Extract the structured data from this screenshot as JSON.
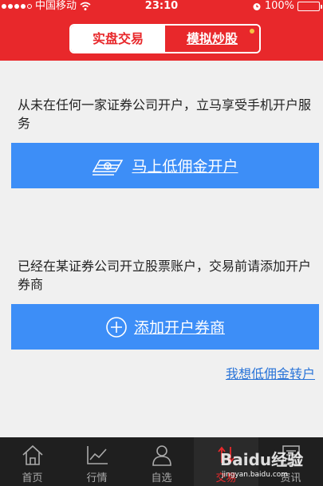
{
  "status": {
    "carrier": "中国移动",
    "time": "23:10",
    "battery": "100%"
  },
  "segment": {
    "active_label": "实盘交易",
    "inactive_label": "模拟炒股"
  },
  "content": {
    "desc1": "从未在任何一家证券公司开户，立马享受手机开户服务",
    "open_button": "马上低佣金开户",
    "desc2": "已经在某证券公司开立股票账户，交易前请添加开户券商",
    "add_button": "添加开户券商",
    "transfer_link": "我想低佣金转户"
  },
  "tabs": [
    {
      "label": "首页",
      "icon": "home-icon"
    },
    {
      "label": "行情",
      "icon": "chart-icon"
    },
    {
      "label": "自选",
      "icon": "person-icon"
    },
    {
      "label": "交易",
      "icon": "trade-icon"
    },
    {
      "label": "资讯",
      "icon": "news-icon"
    }
  ],
  "watermark": {
    "text": "Baidu经验",
    "url": "jingyan.baidu.com"
  },
  "colors": {
    "header": "#e8282b",
    "button": "#3d8ef7",
    "link": "#2a74d8",
    "tabbar": "#1f1f1f"
  }
}
